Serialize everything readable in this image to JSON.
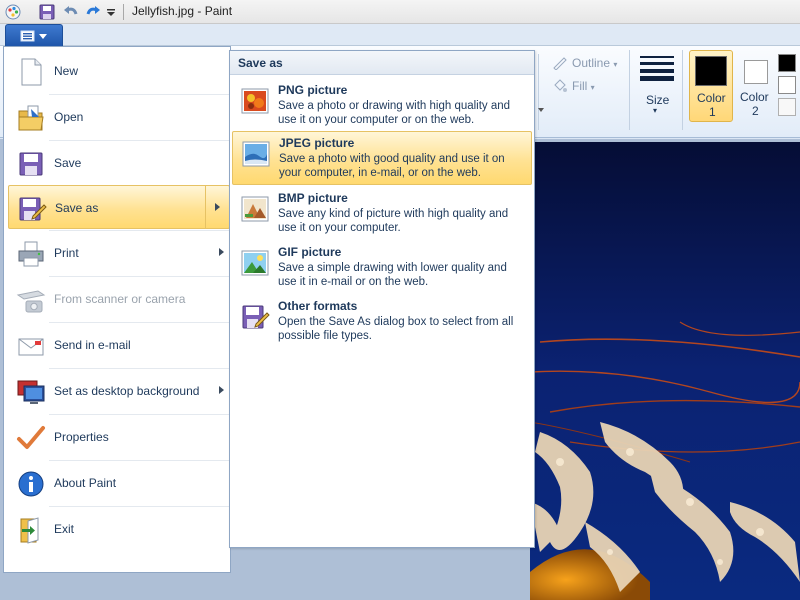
{
  "window": {
    "title": "Jellyfish.jpg - Paint"
  },
  "quick_access": {
    "icons": [
      "paint-app-icon",
      "save-icon",
      "undo-icon",
      "redo-icon",
      "customize-dropdown-icon"
    ]
  },
  "ribbon": {
    "outline_label": "Outline",
    "fill_label": "Fill",
    "size_label": "Size",
    "color1_line1": "Color",
    "color1_line2": "1",
    "color2_line1": "Color",
    "color2_line2": "2",
    "colors": {
      "color1": "#000000",
      "color2": "#ffffff",
      "palette_first": "#000000",
      "palette_second": "#ffffff"
    }
  },
  "app_menu": {
    "items": [
      {
        "label": "New",
        "icon": "new-file-icon"
      },
      {
        "label": "Open",
        "icon": "open-folder-icon"
      },
      {
        "label": "Save",
        "icon": "save-disk-icon"
      },
      {
        "label": "Save as",
        "icon": "save-as-icon",
        "selected": true,
        "has_submenu": true
      },
      {
        "label": "Print",
        "icon": "printer-icon",
        "has_submenu": true
      },
      {
        "label": "From scanner or camera",
        "icon": "scanner-camera-icon",
        "disabled": true
      },
      {
        "label": "Send in e-mail",
        "icon": "email-icon"
      },
      {
        "label": "Set as desktop background",
        "icon": "desktop-background-icon",
        "has_submenu": true
      },
      {
        "label": "Properties",
        "icon": "properties-checkmark-icon"
      },
      {
        "label": "About Paint",
        "icon": "info-icon"
      },
      {
        "label": "Exit",
        "icon": "exit-icon"
      }
    ]
  },
  "save_as_menu": {
    "header": "Save as",
    "items": [
      {
        "title": "PNG picture",
        "description": "Save a photo or drawing with high quality and use it on your computer or on the web.",
        "icon": "png-picture-icon"
      },
      {
        "title": "JPEG picture",
        "description": "Save a photo with good quality and use it on your computer, in e-mail, or on the web.",
        "icon": "jpeg-picture-icon",
        "selected": true
      },
      {
        "title": "BMP picture",
        "description": "Save any kind of picture with high quality and use it on your computer.",
        "icon": "bmp-picture-icon"
      },
      {
        "title": "GIF picture",
        "description": "Save a simple drawing with lower quality and use it in e-mail or on the web.",
        "icon": "gif-picture-icon"
      },
      {
        "title": "Other formats",
        "description": "Open the Save As dialog box to select from all possible file types.",
        "icon": "other-formats-icon"
      }
    ]
  },
  "theme": {
    "highlight": "#ffe293",
    "canvas_water": "#0a1a5c",
    "jellyfish": "#e8d3b4"
  }
}
